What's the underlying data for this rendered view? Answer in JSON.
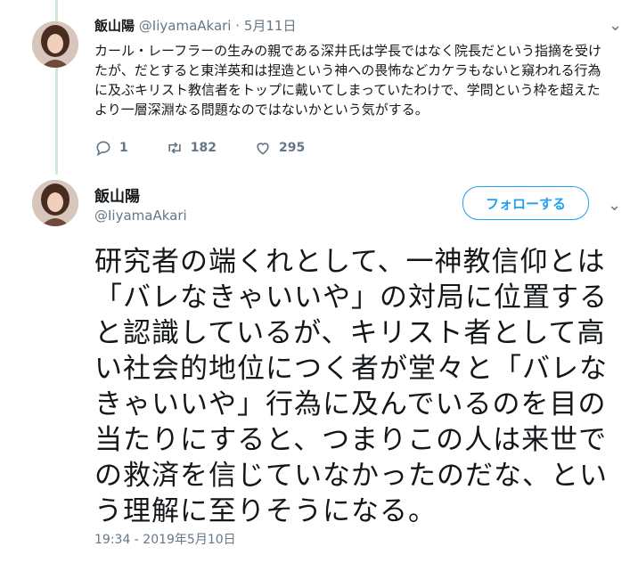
{
  "reply": {
    "name": "飯山陽",
    "handle": "@IiyamaAkari",
    "separator": "·",
    "date": "5月11日",
    "text": "カール・レーフラーの生みの親である深井氏は学長ではなく院長だという指摘を受けたが、だとすると東洋英和は捏造という神への畏怖などカケラもないと窺われる行為に及ぶキリスト教信者をトップに戴いてしまっていたわけで、学問という枠を超えたより一層深淵なる問題なのではないかという気がする。",
    "replies": "1",
    "retweets": "182",
    "likes": "295"
  },
  "main": {
    "name": "飯山陽",
    "handle": "@IiyamaAkari",
    "follow_label": "フォローする",
    "text": "研究者の端くれとして、一神教信仰とは「バレなきゃいいや」の対局に位置すると認識しているが、キリスト者として高い社会的地位につく者が堂々と「バレなきゃいいや」行為に及んでいるのを目の当たりにすると、つまりこの人は来世での救済を信じていなかったのだな、という理解に至りそうになる。",
    "timestamp": "19:34 - 2019年5月10日"
  },
  "icons": {
    "reply": "reply-icon",
    "retweet": "retweet-icon",
    "like": "like-icon",
    "menu": "chevron-down-icon"
  },
  "colors": {
    "accent": "#1da1f2",
    "muted": "#657786",
    "thread_line": "#cfe8d8"
  }
}
